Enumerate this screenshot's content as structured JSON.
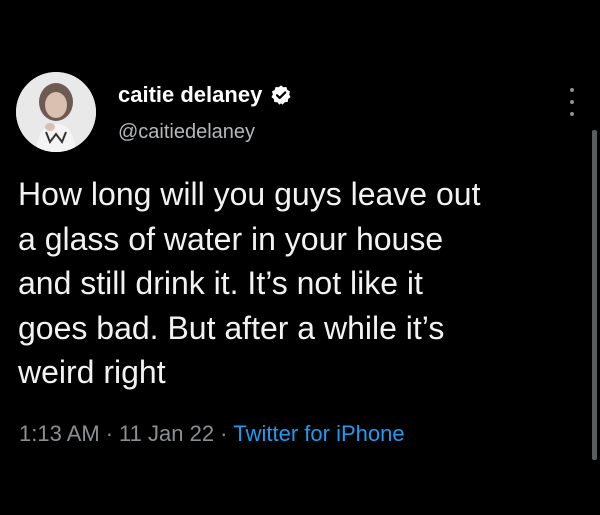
{
  "author": {
    "display_name": "caitie delaney",
    "handle": "@caitiedelaney",
    "verified": true
  },
  "tweet": {
    "lines": [
      "How long will you guys leave out",
      "a glass of water in your house",
      "and still drink it. It’s not like it",
      "goes bad. But after a while it’s",
      "weird right"
    ]
  },
  "meta": {
    "time": "1:13 AM",
    "separator": "·",
    "date": "11 Jan 22",
    "source": "Twitter for iPhone"
  },
  "icons": {
    "verified": "verified-badge-icon",
    "more": "more-vertical-icon"
  },
  "colors": {
    "background": "#000000",
    "link": "#1d9bf0",
    "secondary_text": "#8b8f93",
    "primary_text": "#f2f2f2"
  }
}
